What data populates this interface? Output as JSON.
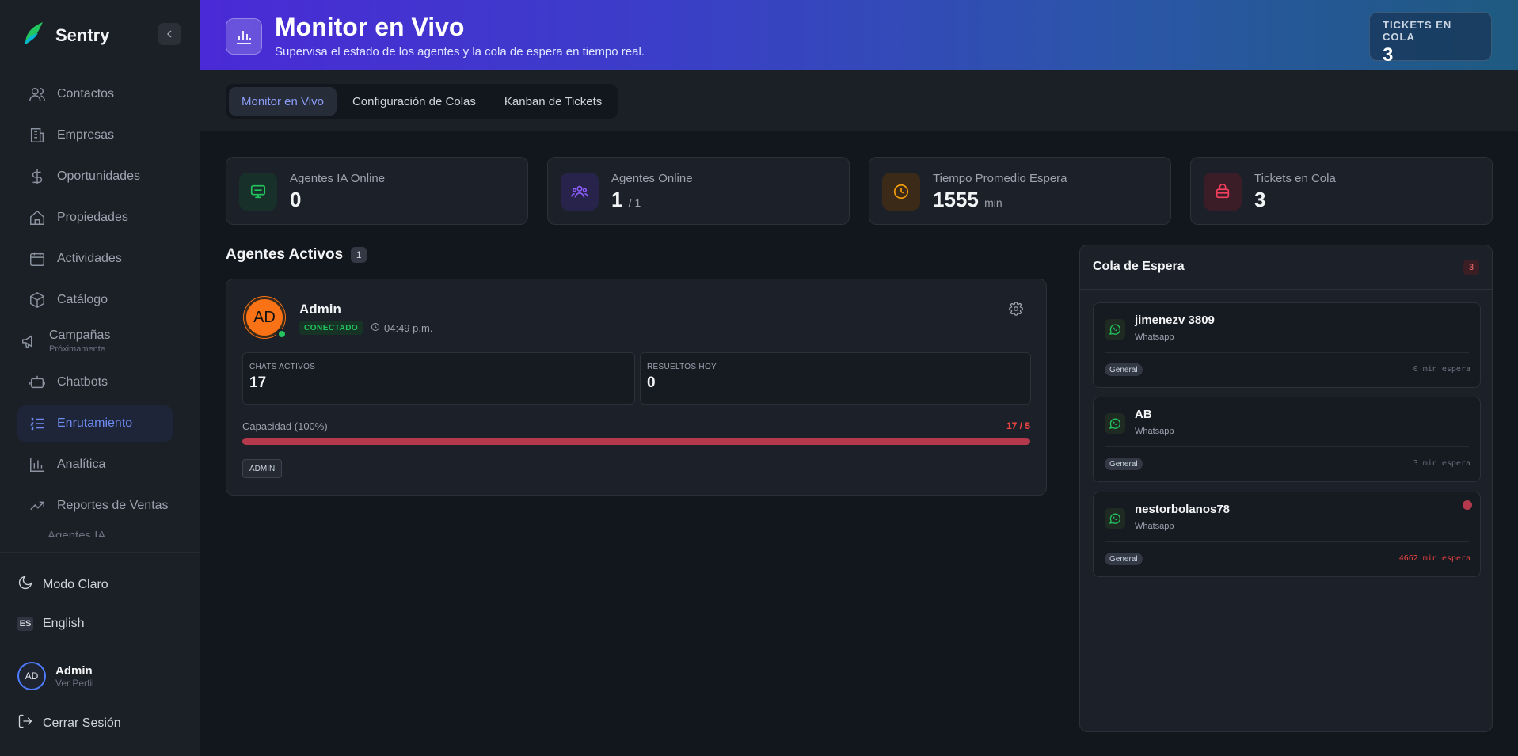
{
  "app": {
    "name": "Sentry"
  },
  "sidebar": {
    "items": [
      {
        "label": "Contactos",
        "icon": "users-icon"
      },
      {
        "label": "Empresas",
        "icon": "building-icon"
      },
      {
        "label": "Oportunidades",
        "icon": "dollar-icon"
      },
      {
        "label": "Propiedades",
        "icon": "home-icon"
      },
      {
        "label": "Actividades",
        "icon": "calendar-icon"
      },
      {
        "label": "Catálogo",
        "icon": "box-icon"
      },
      {
        "label": "Campañas",
        "sublabel": "Próximamente",
        "icon": "megaphone-icon"
      },
      {
        "label": "Chatbots",
        "icon": "bot-icon"
      },
      {
        "label": "Enrutamiento",
        "icon": "list-ordered-icon",
        "active": true
      },
      {
        "label": "Analítica",
        "icon": "bar-chart-icon"
      },
      {
        "label": "Reportes de Ventas",
        "icon": "trending-up-icon"
      },
      {
        "label": "Agentes IA",
        "icon": "sparkles-icon"
      }
    ],
    "bottom": {
      "theme_label": "Modo Claro",
      "lang_code": "ES",
      "lang_label": "English",
      "profile_initials": "AD",
      "profile_name": "Admin",
      "profile_sub": "Ver Perfil",
      "logout_label": "Cerrar Sesión"
    }
  },
  "header": {
    "title": "Monitor en Vivo",
    "subtitle": "Supervisa el estado de los agentes y la cola de espera en tiempo real.",
    "stat_label": "TICKETS EN COLA",
    "stat_value": "3"
  },
  "tabs": [
    {
      "label": "Monitor en Vivo",
      "active": true
    },
    {
      "label": "Configuración de Colas"
    },
    {
      "label": "Kanban de Tickets"
    }
  ],
  "stats": [
    {
      "label": "Agentes IA Online",
      "value": "0",
      "suffix": "",
      "color": "#22c55e",
      "icon": "monitor-icon"
    },
    {
      "label": "Agentes Online",
      "value": "1",
      "suffix": "/ 1",
      "color": "#8b5cf6",
      "icon": "users-icon"
    },
    {
      "label": "Tiempo Promedio Espera",
      "value": "1555",
      "suffix": "min",
      "color": "#f59e0b",
      "icon": "clock-icon"
    },
    {
      "label": "Tickets en Cola",
      "value": "3",
      "suffix": "",
      "color": "#f43f5e",
      "icon": "inbox-icon"
    }
  ],
  "agents_section": {
    "title": "Agentes Activos",
    "count": "1"
  },
  "agent": {
    "initials": "AD",
    "name": "Admin",
    "status": "CONECTADO",
    "time": "04:49 p.m.",
    "metrics": [
      {
        "label": "CHATS ACTIVOS",
        "value": "17"
      },
      {
        "label": "RESUELTOS HOY",
        "value": "0"
      }
    ],
    "capacity_label": "Capacidad (100%)",
    "capacity_ratio": "17 / 5",
    "capacity_percent": 100,
    "role": "ADMIN"
  },
  "queue": {
    "title": "Cola de Espera",
    "count": "3",
    "items": [
      {
        "name": "jimenezv 3809",
        "channel": "Whatsapp",
        "tag": "General",
        "wait": "0 min espera",
        "alert": false
      },
      {
        "name": "AB",
        "channel": "Whatsapp",
        "tag": "General",
        "wait": "3 min espera",
        "alert": false
      },
      {
        "name": "nestorbolanos78",
        "channel": "Whatsapp",
        "tag": "General",
        "wait": "4662 min espera",
        "alert": true
      }
    ]
  }
}
